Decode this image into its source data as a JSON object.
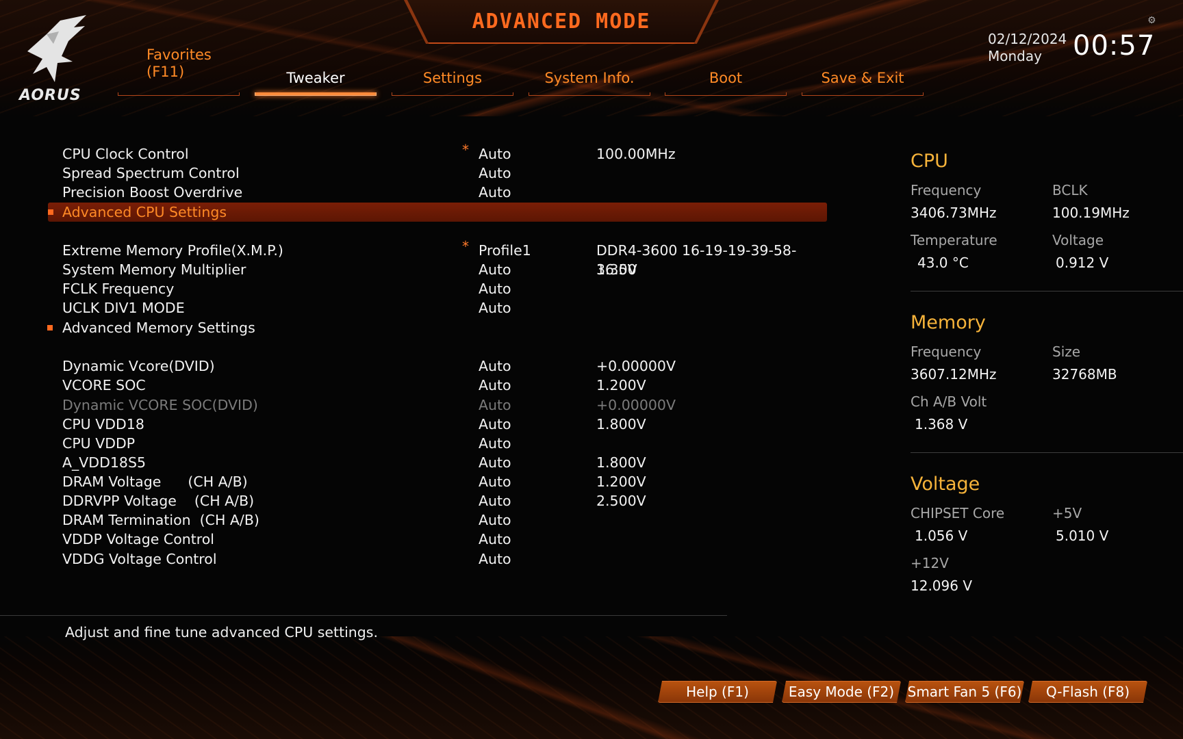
{
  "header": {
    "title": "ADVANCED MODE",
    "logo_text": "AORUS",
    "date": "02/12/2024",
    "weekday": "Monday",
    "time": "00:57"
  },
  "tabs": [
    {
      "label_line1": "Favorites",
      "label_line2": "(F11)",
      "active": false
    },
    {
      "label": "Tweaker",
      "active": true
    },
    {
      "label": "Settings",
      "active": false
    },
    {
      "label": "System Info.",
      "active": false
    },
    {
      "label": "Boot",
      "active": false
    },
    {
      "label": "Save & Exit",
      "active": false
    }
  ],
  "settings": [
    {
      "name": "CPU Clock Control",
      "option": "Auto",
      "value": "100.00MHz",
      "star": "*"
    },
    {
      "name": "Spread Spectrum Control",
      "option": "Auto",
      "value": ""
    },
    {
      "name": "Precision Boost Overdrive",
      "option": "Auto",
      "value": ""
    },
    {
      "name": "Advanced CPU Settings",
      "option": "",
      "value": "",
      "submenu": true,
      "selected": true
    },
    {
      "name": "Extreme Memory Profile(X.M.P.)",
      "option": "Profile1",
      "value": "DDR4-3600 16-19-19-39-58-1.35V",
      "star": "*"
    },
    {
      "name": "System Memory Multiplier",
      "option": "Auto",
      "value": "36.00"
    },
    {
      "name": "FCLK Frequency",
      "option": "Auto",
      "value": ""
    },
    {
      "name": "UCLK DIV1 MODE",
      "option": "Auto",
      "value": ""
    },
    {
      "name": "Advanced Memory Settings",
      "option": "",
      "value": "",
      "submenu": true
    },
    {
      "name": "Dynamic Vcore(DVID)",
      "option": "Auto",
      "value": "+0.00000V"
    },
    {
      "name": "VCORE SOC",
      "option": "Auto",
      "value": "1.200V"
    },
    {
      "name": "Dynamic VCORE SOC(DVID)",
      "option": "Auto",
      "value": "+0.00000V",
      "disabled": true
    },
    {
      "name": "CPU VDD18",
      "option": "Auto",
      "value": "1.800V"
    },
    {
      "name": "CPU VDDP",
      "option": "Auto",
      "value": ""
    },
    {
      "name": "A_VDD18S5",
      "option": "Auto",
      "value": "1.800V"
    },
    {
      "name": "DRAM Voltage      (CH A/B)",
      "option": "Auto",
      "value": "1.200V"
    },
    {
      "name": "DDRVPP Voltage    (CH A/B)",
      "option": "Auto",
      "value": "2.500V"
    },
    {
      "name": "DRAM Termination  (CH A/B)",
      "option": "Auto",
      "value": ""
    },
    {
      "name": "VDDP Voltage Control",
      "option": "Auto",
      "value": ""
    },
    {
      "name": "VDDG Voltage Control",
      "option": "Auto",
      "value": ""
    }
  ],
  "help_text": "Adjust and fine tune advanced CPU settings.",
  "panel": {
    "cpu": {
      "title": "CPU",
      "freq_label": "Frequency",
      "freq_value": "3406.73MHz",
      "bclk_label": "BCLK",
      "bclk_value": "100.19MHz",
      "temp_label": "Temperature",
      "temp_value": "43.0 °C",
      "volt_label": "Voltage",
      "volt_value": "0.912 V"
    },
    "memory": {
      "title": "Memory",
      "freq_label": "Frequency",
      "freq_value": "3607.12MHz",
      "size_label": "Size",
      "size_value": "32768MB",
      "chvolt_label": "Ch A/B Volt",
      "chvolt_value": "1.368 V"
    },
    "voltage": {
      "title": "Voltage",
      "chipset_label": "CHIPSET Core",
      "chipset_value": "1.056 V",
      "v5_label": "+5V",
      "v5_value": "5.010 V",
      "v12_label": "+12V",
      "v12_value": "12.096 V"
    }
  },
  "footer_buttons": [
    "Help (F1)",
    "Easy Mode (F2)",
    "Smart Fan 5 (F6)",
    "Q-Flash (F8)"
  ],
  "colors": {
    "accent": "#ff6a1f",
    "panel_title": "#f6b33a",
    "highlight": "#6e1b05"
  }
}
